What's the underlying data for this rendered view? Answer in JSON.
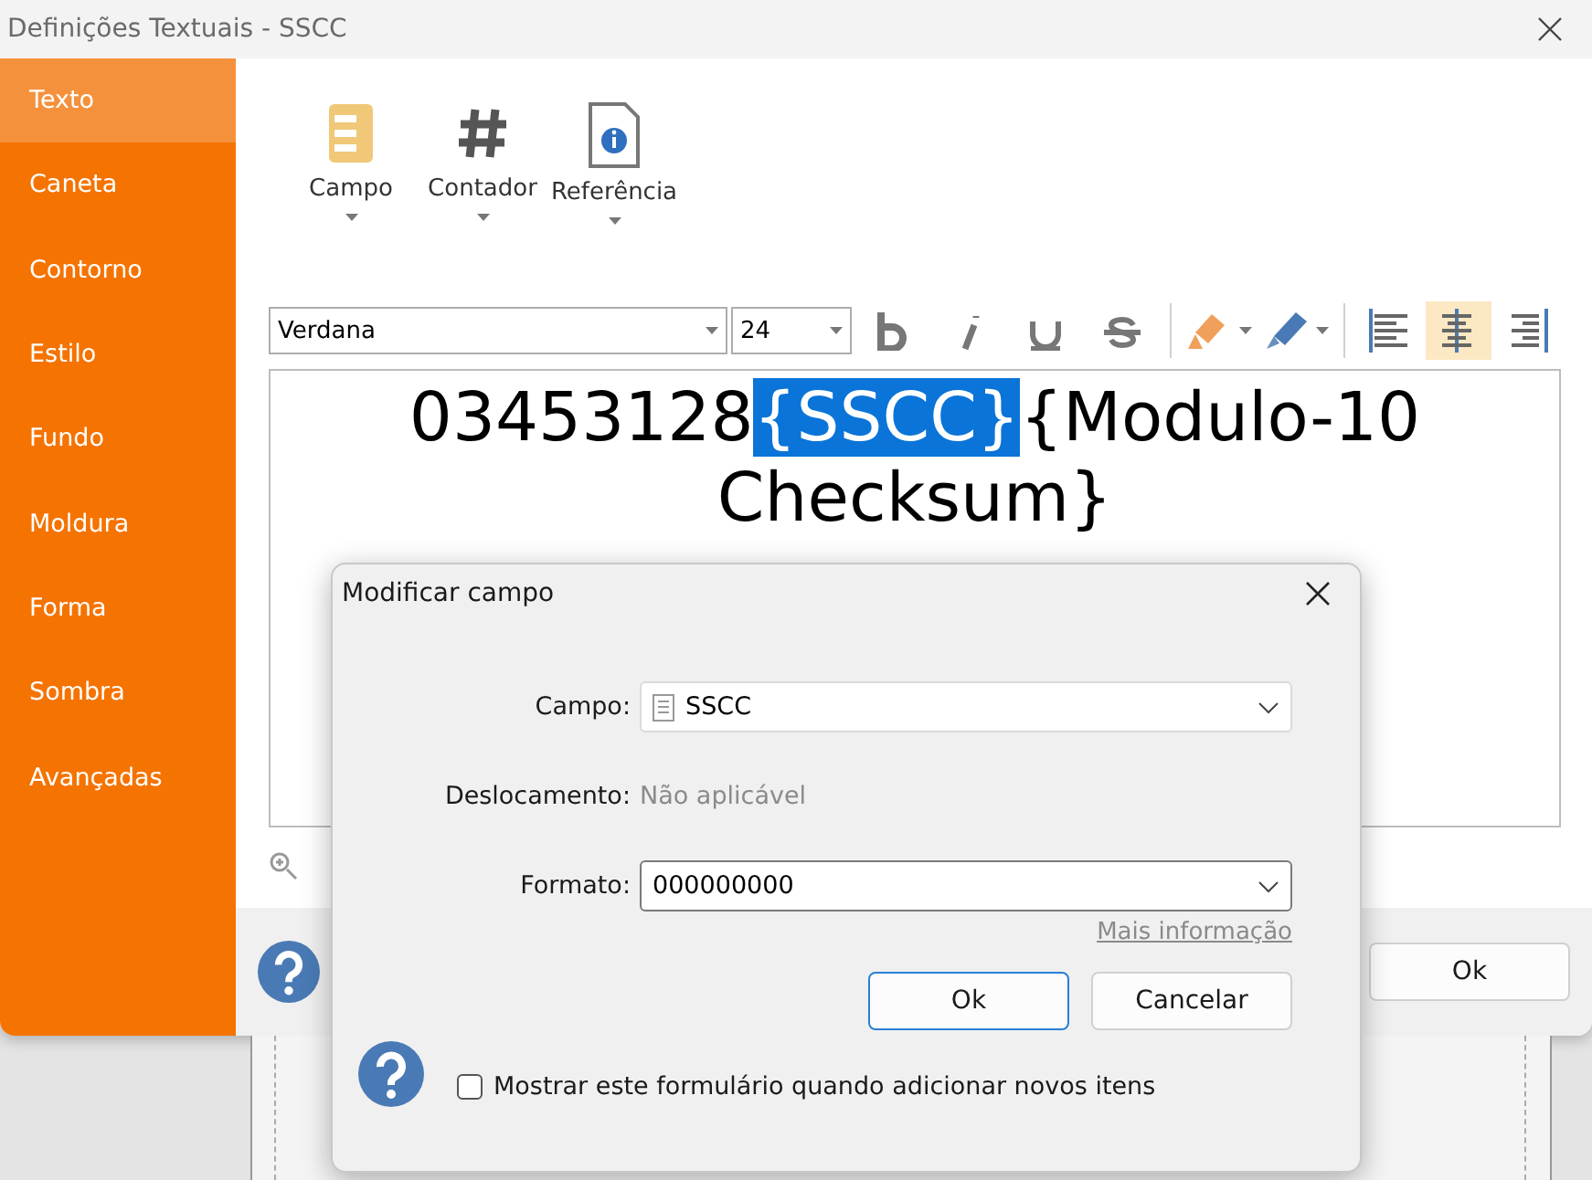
{
  "window": {
    "title": "Definições Textuais - SSCC"
  },
  "sidebar": {
    "items": [
      {
        "label": "Texto",
        "selected": true
      },
      {
        "label": "Caneta",
        "selected": false
      },
      {
        "label": "Contorno",
        "selected": false
      },
      {
        "label": "Estilo",
        "selected": false
      },
      {
        "label": "Fundo",
        "selected": false
      },
      {
        "label": "Moldura",
        "selected": false
      },
      {
        "label": "Forma",
        "selected": false
      },
      {
        "label": "Sombra",
        "selected": false
      },
      {
        "label": "Avançadas",
        "selected": false
      }
    ]
  },
  "insert_toolbar": [
    {
      "kind": "field",
      "label": "Campo"
    },
    {
      "kind": "counter",
      "label": "Contador"
    },
    {
      "kind": "reference",
      "label": "Referência"
    }
  ],
  "format_toolbar": {
    "font": "Verdana",
    "size": "24",
    "styles": [
      {
        "kind": "bold"
      },
      {
        "kind": "italic"
      },
      {
        "kind": "underline"
      },
      {
        "kind": "strike"
      }
    ],
    "alignments": [
      {
        "kind": "left",
        "selected": false
      },
      {
        "kind": "center",
        "selected": true
      },
      {
        "kind": "right",
        "selected": false
      }
    ]
  },
  "editor": {
    "segments": [
      {
        "text": "03453128",
        "selected": false
      },
      {
        "text": "{SSCC}",
        "selected": true
      },
      {
        "text": "{Modulo-10 Checksum}",
        "selected": false
      }
    ]
  },
  "footer": {
    "ok": "Ok"
  },
  "dialog": {
    "title": "Modificar campo",
    "field_label": "Campo:",
    "field_value": "SSCC",
    "offset_label": "Deslocamento:",
    "offset_value": "Não aplicável",
    "format_label": "Formato:",
    "format_value": "000000000",
    "more_info": "Mais informação",
    "ok": "Ok",
    "cancel": "Cancelar",
    "show_form": {
      "label": "Mostrar este formulário quando adicionar novos itens",
      "checked": false
    }
  }
}
